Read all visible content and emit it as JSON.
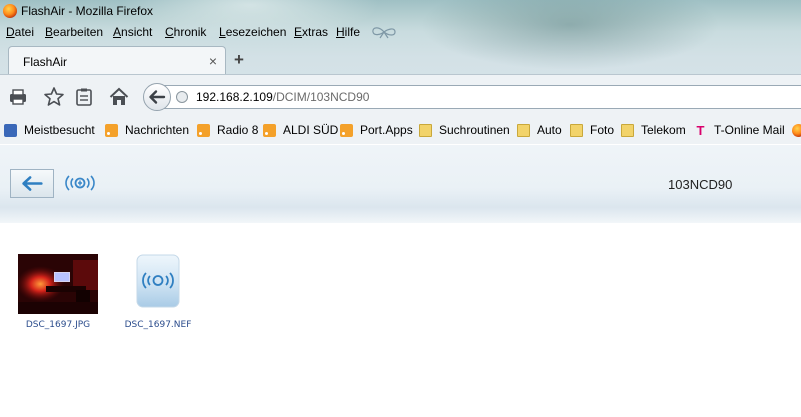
{
  "window": {
    "title": "FlashAir - Mozilla Firefox"
  },
  "menu": [
    "Datei",
    "Bearbeiten",
    "Ansicht",
    "Chronik",
    "Lesezeichen",
    "Extras",
    "Hilfe"
  ],
  "tab": {
    "title": "FlashAir",
    "close": "×",
    "new_tab": "+"
  },
  "url": {
    "host": "192.168.2.109",
    "path": "/DCIM/103NCD90"
  },
  "bookmarks": [
    {
      "label": "Meistbesucht",
      "icon": "magnifier-icon"
    },
    {
      "label": "Nachrichten",
      "icon": "rss-icon"
    },
    {
      "label": "Radio 8",
      "icon": "rss-icon"
    },
    {
      "label": "ALDI SÜD",
      "icon": "rss-icon"
    },
    {
      "label": "Port.Apps",
      "icon": "rss-icon"
    },
    {
      "label": "Suchroutinen",
      "icon": "folder-icon"
    },
    {
      "label": "Auto",
      "icon": "folder-icon"
    },
    {
      "label": "Foto",
      "icon": "folder-icon"
    },
    {
      "label": "Telekom",
      "icon": "folder-icon"
    },
    {
      "label": "T-Online Mail",
      "icon": "telekom-icon"
    }
  ],
  "page": {
    "folder_title": "103NCD90",
    "files": [
      {
        "name": "DSC_1697.JPG",
        "type": "image"
      },
      {
        "name": "DSC_1697.NEF",
        "type": "raw"
      }
    ]
  },
  "colors": {
    "accent": "#3a87c8",
    "file_link": "#2b4c8c",
    "chrome": "#d3e1e6"
  }
}
